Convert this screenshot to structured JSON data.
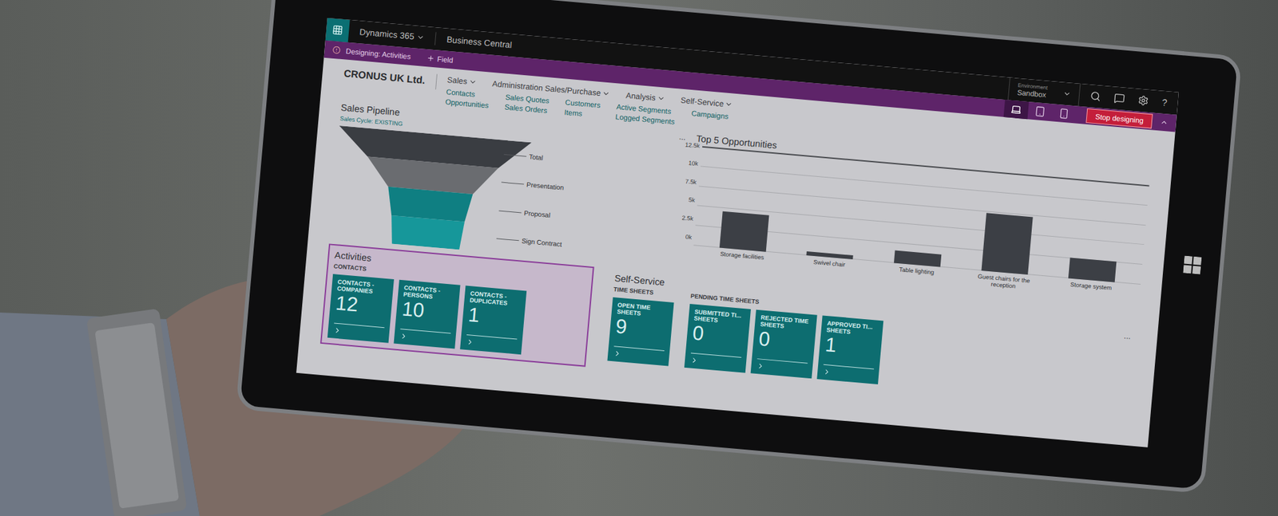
{
  "app_bar": {
    "product": "Dynamics 365",
    "app": "Business Central",
    "environment_label": "Environment",
    "environment": "Sandbox"
  },
  "design_bar": {
    "title": "Designing: Activities",
    "action": "Field",
    "stop_button": "Stop designing",
    "help": "?"
  },
  "devices": [
    {
      "kind": "laptop",
      "selected": true
    },
    {
      "kind": "tablet",
      "selected": false
    },
    {
      "kind": "phone",
      "selected": false
    }
  ],
  "company": "CRONUS UK Ltd.",
  "menus": [
    "Sales",
    "Administration Sales/Purchase",
    "Analysis",
    "Self-Service"
  ],
  "link_columns": [
    [
      "Contacts",
      "Opportunities"
    ],
    [
      "Sales Quotes",
      "Sales Orders"
    ],
    [
      "Customers",
      "Items"
    ],
    [
      "Active Segments",
      "Logged Segments"
    ],
    [
      "Campaigns"
    ]
  ],
  "sales_pipeline": {
    "title": "Sales Pipeline",
    "subtitle": "Sales Cycle: EXISTING",
    "stages": [
      {
        "label": "Total",
        "value": 100,
        "color": "#3a3d42"
      },
      {
        "label": "Presentation",
        "value": 68,
        "color": "#6a6c70"
      },
      {
        "label": "Proposal",
        "value": 44,
        "color": "#0f7f82"
      },
      {
        "label": "Sign Contract",
        "value": 38,
        "color": "#16979a"
      }
    ]
  },
  "top_opportunities": {
    "title": "Top 5 Opportunities",
    "more": "...",
    "axis_max": 12.5,
    "ticks": [
      "12.5k",
      "10k",
      "7.5k",
      "5k",
      "2.5k",
      "0k"
    ],
    "bars": [
      {
        "label": "Storage facilities",
        "value": 4.6
      },
      {
        "label": "Swivel chair",
        "value": 0.5
      },
      {
        "label": "Table lighting",
        "value": 1.6
      },
      {
        "label": "Guest chairs for the reception",
        "value": 7.2
      },
      {
        "label": "Storage system",
        "value": 2.6
      }
    ]
  },
  "activities": {
    "title": "Activities",
    "selected": true,
    "group": "CONTACTS",
    "tiles": [
      {
        "label": "CONTACTS - COMPANIES",
        "count": "12"
      },
      {
        "label": "CONTACTS - PERSONS",
        "count": "10"
      },
      {
        "label": "CONTACTS - DUPLICATES",
        "count": "1"
      }
    ]
  },
  "self_service": {
    "title": "Self-Service",
    "more": "...",
    "groups": [
      {
        "label": "TIME SHEETS",
        "tiles": [
          {
            "label": "OPEN TIME SHEETS",
            "count": "9"
          }
        ]
      },
      {
        "label": "PENDING TIME SHEETS",
        "tiles": [
          {
            "label": "SUBMITTED TI... SHEETS",
            "count": "0"
          },
          {
            "label": "REJECTED TIME SHEETS",
            "count": "0"
          },
          {
            "label": "APPROVED TI... SHEETS",
            "count": "1"
          }
        ]
      }
    ]
  }
}
